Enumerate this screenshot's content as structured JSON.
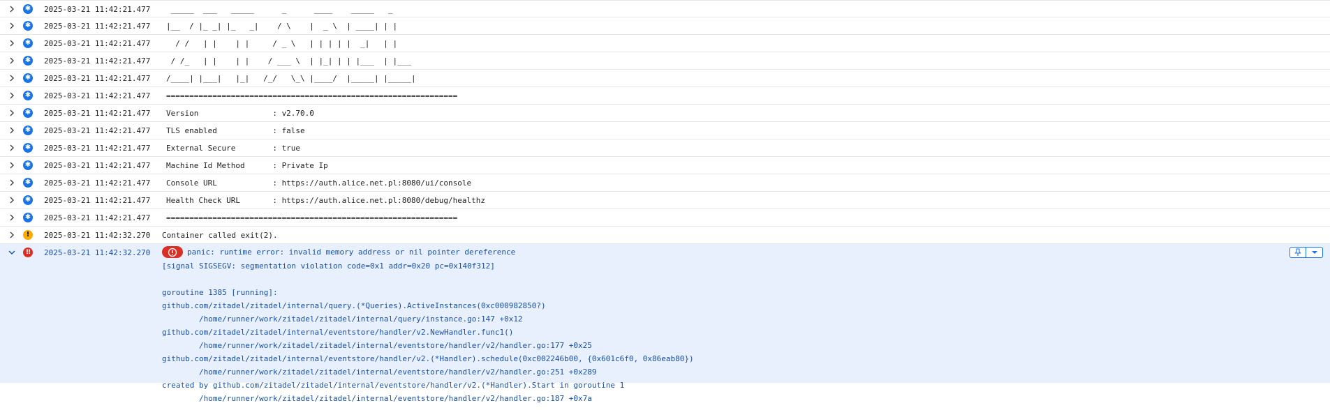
{
  "colors": {
    "info": "#1a73e8",
    "warning": "#f9ab00",
    "error": "#d93025",
    "expanded_bg": "#e8f0fe",
    "expanded_text": "#174ea6"
  },
  "icons": {
    "row_toggle": "chevron-right-icon",
    "expanded_toggle": "chevron-down-icon",
    "info": "info-icon",
    "warning": "warning-icon",
    "error": "error-icon",
    "panic_chip": "panic-icon",
    "pin": "pin-icon",
    "menu": "dropdown-arrow-icon"
  },
  "entries": [
    {
      "timestamp": "2025-03-21 11:42:21.477",
      "severity": "info",
      "message": " _____  ___   _____      _      ____    _____   _"
    },
    {
      "timestamp": "2025-03-21 11:42:21.477",
      "severity": "info",
      "message": "|__  / |_ _| |_   _|    / \\    |  _ \\  | ____| | |"
    },
    {
      "timestamp": "2025-03-21 11:42:21.477",
      "severity": "info",
      "message": "  / /   | |    | |     / _ \\   | | | | |  _|   | |"
    },
    {
      "timestamp": "2025-03-21 11:42:21.477",
      "severity": "info",
      "message": " / /_   | |    | |    / ___ \\  | |_| | | |___  | |___"
    },
    {
      "timestamp": "2025-03-21 11:42:21.477",
      "severity": "info",
      "message": "/____| |___|   |_|   /_/   \\_\\ |____/  |_____| |_____|"
    },
    {
      "timestamp": "2025-03-21 11:42:21.477",
      "severity": "info",
      "message": "==============================================================="
    },
    {
      "timestamp": "2025-03-21 11:42:21.477",
      "severity": "info",
      "message": "Version                : v2.70.0"
    },
    {
      "timestamp": "2025-03-21 11:42:21.477",
      "severity": "info",
      "message": "TLS enabled            : false"
    },
    {
      "timestamp": "2025-03-21 11:42:21.477",
      "severity": "info",
      "message": "External Secure        : true"
    },
    {
      "timestamp": "2025-03-21 11:42:21.477",
      "severity": "info",
      "message": "Machine Id Method      : Private Ip"
    },
    {
      "timestamp": "2025-03-21 11:42:21.477",
      "severity": "info",
      "message": "Console URL            : https://auth.alice.net.pl:8080/ui/console"
    },
    {
      "timestamp": "2025-03-21 11:42:21.477",
      "severity": "info",
      "message": "Health Check URL       : https://auth.alice.net.pl:8080/debug/healthz"
    },
    {
      "timestamp": "2025-03-21 11:42:21.477",
      "severity": "info",
      "message": "==============================================================="
    },
    {
      "timestamp": "2025-03-21 11:42:32.270",
      "severity": "warning",
      "message": "Container called exit(2)."
    }
  ],
  "expanded": {
    "timestamp": "2025-03-21 11:42:32.270",
    "severity": "error",
    "headline": "panic: runtime error: invalid memory address or nil pointer dereference",
    "body": "[signal SIGSEGV: segmentation violation code=0x1 addr=0x20 pc=0x140f312]\n\ngoroutine 1385 [running]:\ngithub.com/zitadel/zitadel/internal/query.(*Queries).ActiveInstances(0xc000982850?)\n        /home/runner/work/zitadel/zitadel/internal/query/instance.go:147 +0x12\ngithub.com/zitadel/zitadel/internal/eventstore/handler/v2.NewHandler.func1()\n        /home/runner/work/zitadel/zitadel/internal/eventstore/handler/v2/handler.go:177 +0x25\ngithub.com/zitadel/zitadel/internal/eventstore/handler/v2.(*Handler).schedule(0xc002246b00, {0x601c6f0, 0x86eab80})\n        /home/runner/work/zitadel/zitadel/internal/eventstore/handler/v2/handler.go:251 +0x289\ncreated by github.com/zitadel/zitadel/internal/eventstore/handler/v2.(*Handler).Start in goroutine 1\n        /home/runner/work/zitadel/zitadel/internal/eventstore/handler/v2/handler.go:187 +0x7a"
  }
}
